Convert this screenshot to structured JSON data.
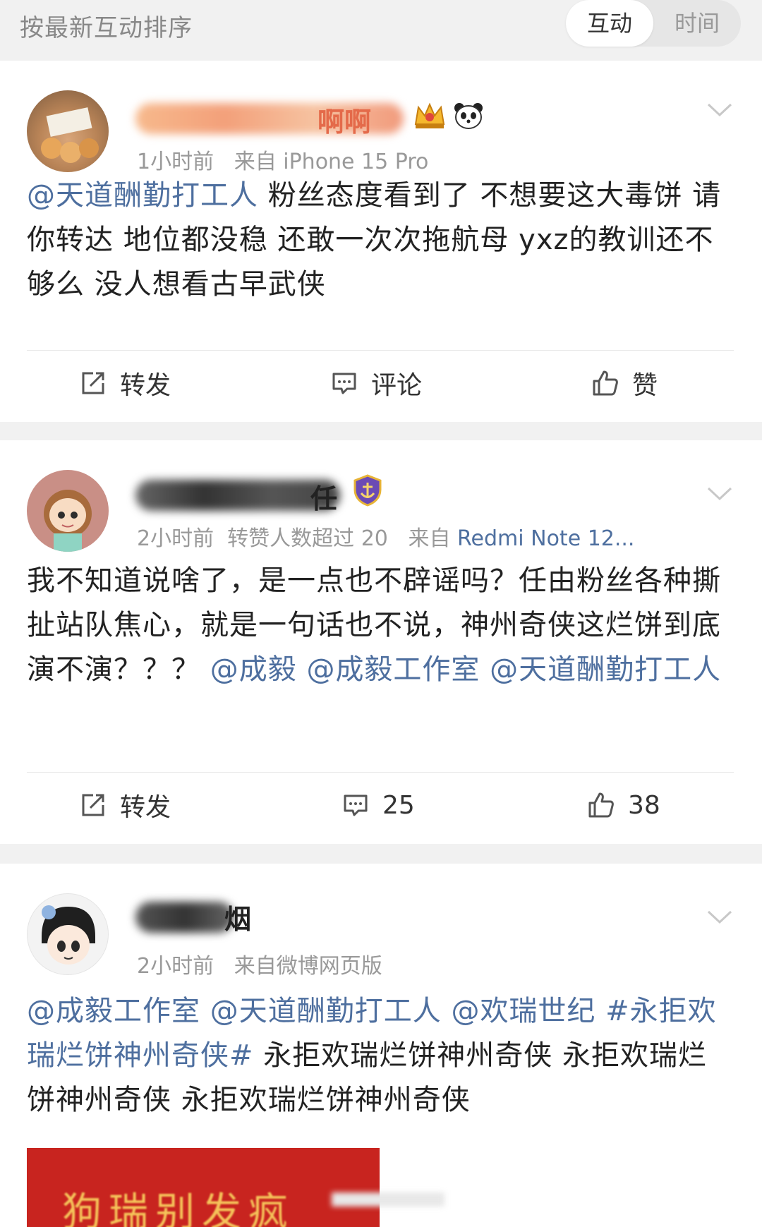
{
  "sort_bar": {
    "label": "按最新互动排序",
    "options": [
      "互动",
      "时间"
    ],
    "active": "互动"
  },
  "colors": {
    "link": "#4e6f9f",
    "meta": "#999999",
    "background": "#f1f1f1"
  },
  "comments": [
    {
      "name_suffix": "啊啊",
      "meta": {
        "time": "1小时前",
        "source_prefix": "来自",
        "source": "iPhone 15 Pro"
      },
      "mention": "@天道酬勤打工人",
      "text": " 粉丝态度看到了 不想要这大毒饼 请你转达 地位都没稳 还敢一次次拖航母 yxz的教训还不够么 没人想看古早武侠",
      "actions": {
        "repost": "转发",
        "comment": "评论",
        "like": "赞"
      },
      "icons": [
        "crown-badge-icon",
        "panda-badge-icon",
        "chevron-down-icon",
        "repost-icon",
        "comment-icon",
        "like-icon"
      ]
    },
    {
      "name_suffix": "任",
      "meta": {
        "time": "2小时前",
        "extra": "转赞人数超过 20",
        "source_prefix": "来自",
        "source": "Redmi Note 12..."
      },
      "text": "我不知道说啥了，是一点也不辟谣吗？任由粉丝各种撕扯站队焦心，就是一句话也不说，神州奇侠这烂饼到底演不演？？？ ",
      "mentions": [
        "@成毅",
        "@成毅工作室",
        "@天道酬勤打工人"
      ],
      "actions": {
        "repost": "转发",
        "comment": "25",
        "like": "38"
      },
      "icons": [
        "anchor-shield-badge-icon",
        "chevron-down-icon",
        "repost-icon",
        "comment-icon",
        "like-icon"
      ]
    },
    {
      "name_suffix": "烟",
      "meta": {
        "time": "2小时前",
        "source_prefix": "来自",
        "source": "微博网页版"
      },
      "mentions": [
        "@成毅工作室",
        "@天道酬勤打工人",
        "@欢瑞世纪"
      ],
      "hashtag": "#永拒欢瑞烂饼神州奇侠#",
      "text": " 永拒欢瑞烂饼神州奇侠 永拒欢瑞烂饼神州奇侠 永拒欢瑞烂饼神州奇侠",
      "promo_text": "狗瑞别发疯",
      "icons": [
        "chevron-down-icon"
      ]
    }
  ]
}
